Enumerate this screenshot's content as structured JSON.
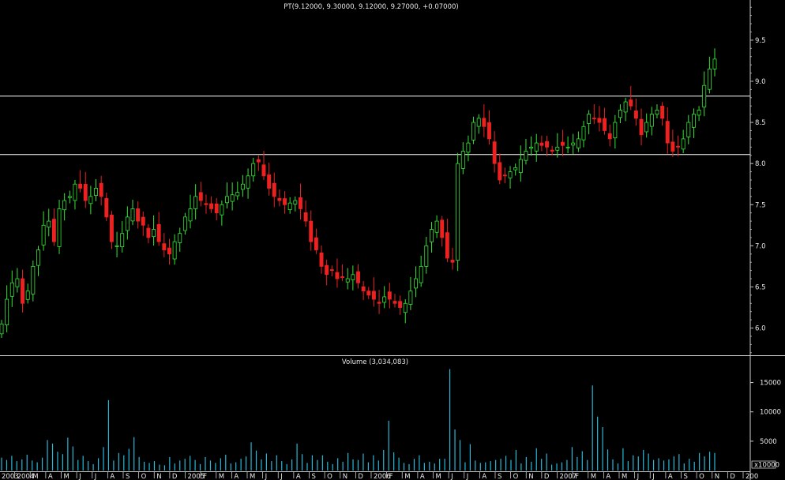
{
  "chart_data": {
    "type": "candlestick",
    "price_panel": {
      "title": "PT(9.12000, 9.30000, 9.12000, 9.27000, +0.07000)",
      "y_ticks": [
        "6.0",
        "6.5",
        "7.0",
        "7.5",
        "8.0",
        "8.5",
        "9.0",
        "9.5"
      ],
      "ylim": [
        5.65,
        9.95
      ],
      "horizontal_lines": [
        8.82,
        8.11
      ],
      "series_close": [
        6.05,
        6.35,
        6.55,
        6.6,
        6.3,
        6.45,
        6.75,
        6.95,
        7.25,
        7.3,
        7.05,
        7.45,
        7.55,
        7.6,
        7.75,
        7.7,
        7.55,
        7.6,
        7.7,
        7.6,
        7.35,
        7.05,
        7.0,
        7.15,
        7.35,
        7.45,
        7.3,
        7.25,
        7.1,
        7.2,
        7.05,
        6.95,
        6.9,
        7.05,
        7.15,
        7.35,
        7.45,
        7.6,
        7.55,
        7.5,
        7.45,
        7.4,
        7.5,
        7.6,
        7.62,
        7.65,
        7.75,
        7.85,
        8.0,
        8.02,
        7.85,
        7.7,
        7.6,
        7.55,
        7.5,
        7.52,
        7.55,
        7.45,
        7.3,
        7.05,
        6.95,
        6.75,
        6.65,
        6.7,
        6.6,
        6.62,
        6.6,
        6.65,
        6.55,
        6.45,
        6.4,
        6.35,
        6.3,
        6.38,
        6.35,
        6.3,
        6.25,
        6.3,
        6.45,
        6.6,
        6.75,
        7.0,
        7.2,
        7.3,
        7.1,
        6.85,
        6.8,
        8.0,
        8.15,
        8.25,
        8.5,
        8.55,
        8.45,
        8.3,
        8.0,
        7.8,
        7.85,
        7.9,
        7.95,
        8.05,
        8.15,
        8.2,
        8.25,
        8.22,
        8.2,
        8.15,
        8.2,
        8.22,
        8.2,
        8.25,
        8.3,
        8.45,
        8.6,
        8.55,
        8.5,
        8.4,
        8.3,
        8.5,
        8.65,
        8.75,
        8.7,
        8.55,
        8.35,
        8.5,
        8.6,
        8.65,
        8.55,
        8.25,
        8.15,
        8.2,
        8.3,
        8.5,
        8.6,
        8.65,
        8.95,
        9.15,
        9.27
      ]
    },
    "volume_panel": {
      "title": "Volume (3,034,083)",
      "y_ticks": [
        "5000",
        "10000",
        "15000"
      ],
      "unit_label": "x10000",
      "ylim": [
        0,
        17500
      ],
      "values": [
        2200,
        1800,
        2500,
        1600,
        1900,
        2700,
        1700,
        1400,
        2200,
        5200,
        4600,
        3200,
        2800,
        5600,
        4100,
        1800,
        2500,
        1600,
        1100,
        2100,
        4000,
        12000,
        1700,
        3000,
        2600,
        3700,
        5700,
        2300,
        1500,
        1300,
        1600,
        1000,
        900,
        2300,
        1200,
        1700,
        2000,
        2500,
        1800,
        1100,
        2300,
        1700,
        1300,
        2100,
        2700,
        1200,
        1400,
        2000,
        2400,
        4800,
        3400,
        1900,
        2900,
        1600,
        2600,
        1600,
        1100,
        1900,
        4600,
        2800,
        1300,
        2600,
        1800,
        2600,
        1500,
        1100,
        2100,
        1500,
        3000,
        1900,
        1800,
        2900,
        1400,
        2600,
        1700,
        3500,
        8500,
        3100,
        2200,
        1300,
        1100,
        2000,
        2600,
        1300,
        1500,
        1200,
        2000,
        2000,
        17300,
        7000,
        5200,
        1400,
        4500,
        1700,
        1300,
        1400,
        1600,
        1800,
        2000,
        2500,
        1800,
        3500,
        1200,
        2300,
        1500,
        3800,
        2000,
        2900,
        1000,
        1200,
        1400,
        1800,
        4000,
        2300,
        3300,
        1800,
        14500,
        9200,
        7400,
        3600,
        1900,
        1200,
        3800,
        1600,
        2600,
        2400,
        3500,
        2900,
        1800,
        2100,
        1700,
        1900,
        2400,
        2800,
        1200,
        2000,
        1500,
        3000,
        2400,
        3200,
        3000
      ]
    },
    "x_labels": [
      "2003",
      "2004",
      "M",
      "A",
      "M",
      "J",
      "J",
      "A",
      "S",
      "O",
      "N",
      "D",
      "2005",
      "F",
      "M",
      "A",
      "M",
      "J",
      "J",
      "A",
      "S",
      "O",
      "N",
      "D",
      "2006",
      "F",
      "M",
      "A",
      "M",
      "J",
      "J",
      "A",
      "S",
      "O",
      "N",
      "D",
      "2007",
      "F",
      "M",
      "A",
      "M",
      "J",
      "J",
      "A",
      "S",
      "O",
      "N",
      "D",
      "200"
    ],
    "colors": {
      "background": "#000000",
      "up": "#33e633",
      "down": "#ee2020",
      "volume": "#28b8d8",
      "line": "#ffffff",
      "text": "#e8e8e8"
    }
  }
}
